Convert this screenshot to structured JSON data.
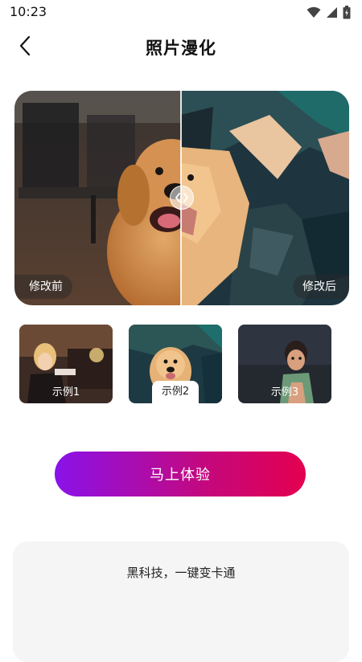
{
  "status_bar": {
    "time": "10:23",
    "icons": [
      "wifi-icon",
      "signal-icon",
      "battery-icon"
    ]
  },
  "header": {
    "back_icon": "back-arrow-icon",
    "title": "照片漫化"
  },
  "compare": {
    "before_label": "修改前",
    "after_label": "修改后",
    "handle_icon": "compare-handle-icon"
  },
  "samples": [
    {
      "label": "示例1",
      "selected": false
    },
    {
      "label": "示例2",
      "selected": true
    },
    {
      "label": "示例3",
      "selected": false
    }
  ],
  "cta": {
    "label": "马上体验"
  },
  "info": {
    "text": "黑科技，一键变卡通"
  },
  "colors": {
    "gradient_start": "#8a12ea",
    "gradient_end": "#e4004f",
    "card_bg": "#f5f5f5"
  }
}
